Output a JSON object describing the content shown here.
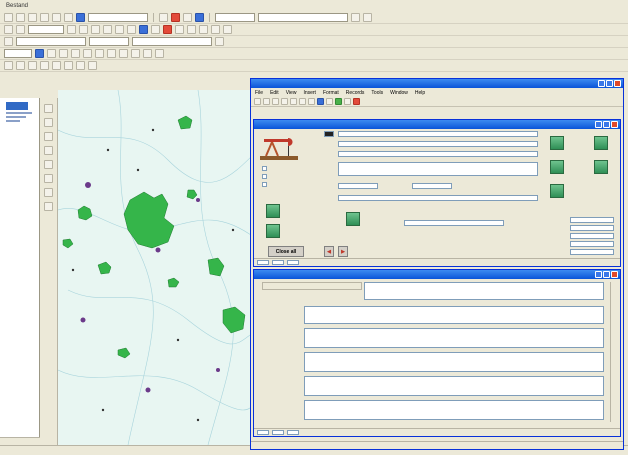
{
  "app": {
    "menu": [
      "Bestand",
      "",
      "",
      "",
      "",
      ""
    ]
  },
  "utilities_window": {
    "title": "",
    "menu": [
      "File",
      "Edit",
      "View",
      "Insert",
      "Format",
      "Records",
      "Tools",
      "Window",
      "Help"
    ]
  },
  "basin_form": {
    "title": "",
    "field_labels": [
      "",
      "",
      "",
      "",
      "",
      ""
    ],
    "field_values": [
      "",
      "",
      "",
      "",
      "",
      ""
    ],
    "checkboxes": [
      "",
      "",
      ""
    ],
    "side_buttons": [
      "",
      "",
      "",
      ""
    ],
    "right_labels": [
      "",
      "",
      "",
      "",
      "",
      ""
    ],
    "close_label": "Close all"
  },
  "comments_form": {
    "title": "",
    "header_label": "",
    "comment_labels": [
      "",
      "",
      "",
      "",
      "",
      ""
    ],
    "first_comment": ""
  },
  "colors": {
    "title_bar": "#0a54d8",
    "field_green": "#35b54a",
    "map_background": "#e8f6f2",
    "green_button": "#2f8f56"
  }
}
